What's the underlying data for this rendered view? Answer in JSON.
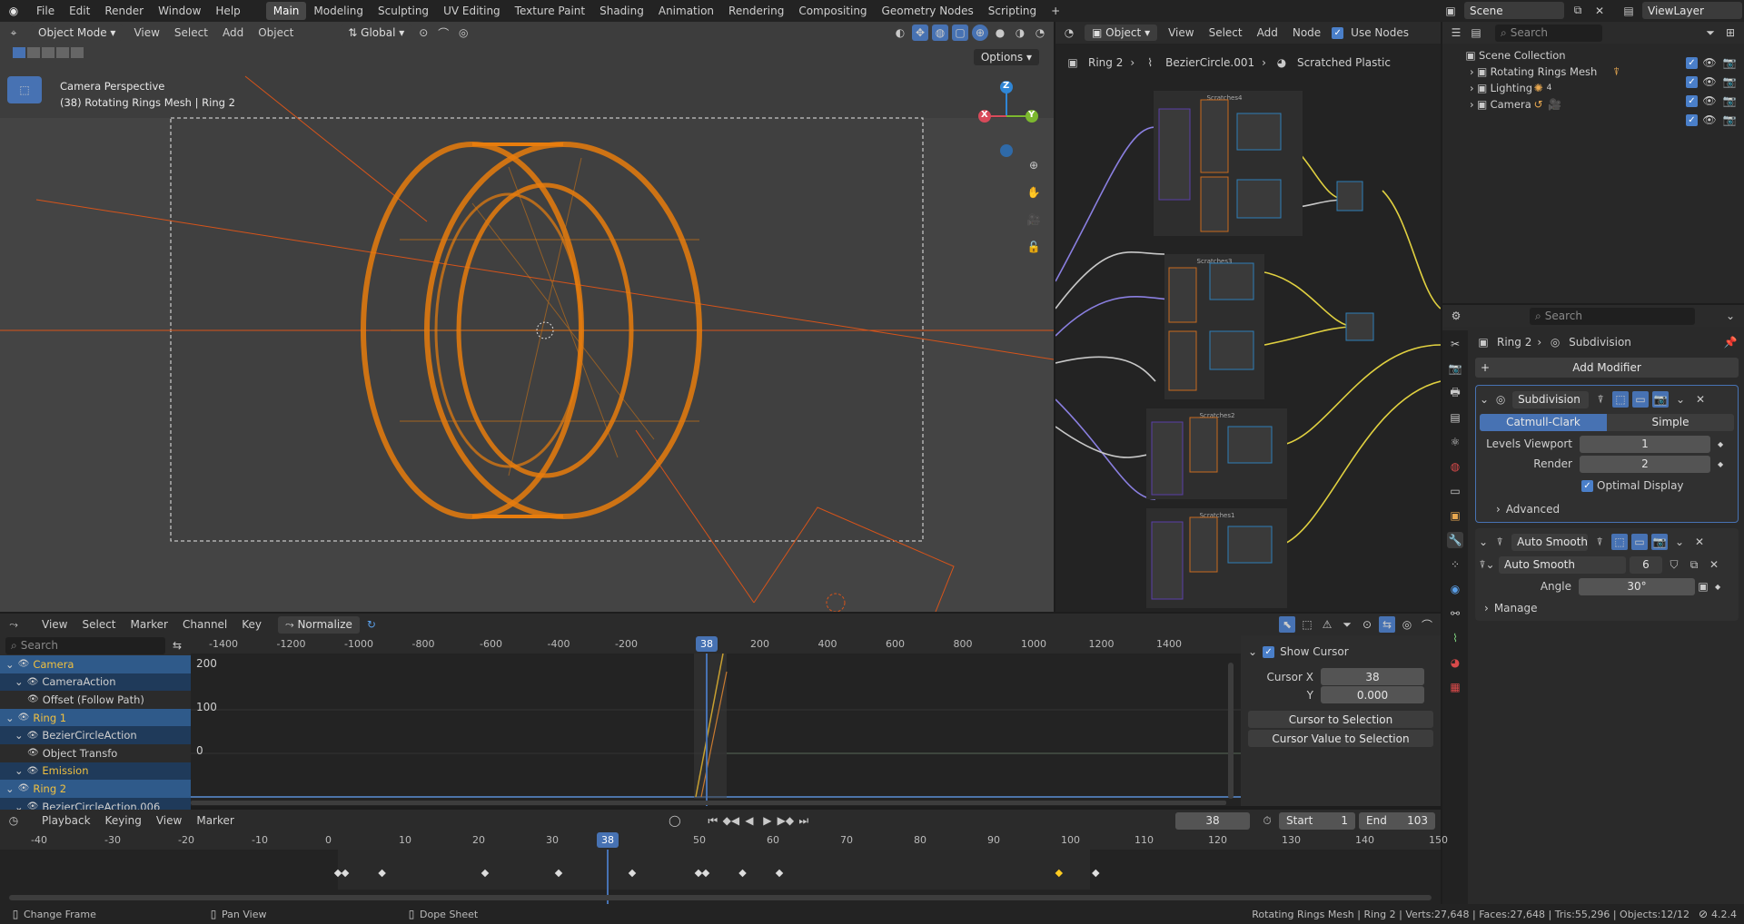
{
  "topbar": {
    "menus": [
      "File",
      "Edit",
      "Render",
      "Window",
      "Help"
    ],
    "workspaces": [
      "Main",
      "Modeling",
      "Sculpting",
      "UV Editing",
      "Texture Paint",
      "Shading",
      "Animation",
      "Rendering",
      "Compositing",
      "Geometry Nodes",
      "Scripting"
    ],
    "active_workspace": "Main",
    "add_tab": "+",
    "scene_label": "Scene",
    "viewlayer_label": "ViewLayer"
  },
  "viewport": {
    "mode": "Object Mode",
    "menus": [
      "View",
      "Select",
      "Add",
      "Object"
    ],
    "orientation": "Global",
    "options_label": "Options",
    "overlay_title": "Camera Perspective",
    "overlay_subtitle": "(38) Rotating Rings Mesh | Ring 2",
    "gizmo": {
      "x": "X",
      "y": "Y",
      "z": "Z"
    }
  },
  "node_editor": {
    "type": "Object",
    "menus": [
      "View",
      "Select",
      "Add",
      "Node"
    ],
    "use_nodes_label": "Use Nodes",
    "breadcrumb": [
      "Ring 2",
      "BezierCircle.001",
      "Scratched Plastic"
    ],
    "frame_titles": [
      "Scratches4",
      "Scratches3",
      "Scratches2",
      "Scratches1"
    ]
  },
  "outliner": {
    "search_placeholder": "Search",
    "root": "Scene Collection",
    "items": [
      {
        "label": "Rotating Rings Mesh"
      },
      {
        "label": "Lighting",
        "badge": "4"
      },
      {
        "label": "Camera"
      }
    ]
  },
  "properties": {
    "search_placeholder": "Search",
    "breadcrumb_object": "Ring 2",
    "breadcrumb_modifier": "Subdivision",
    "add_modifier": "Add Modifier",
    "subdivision": {
      "name": "Subdivision",
      "mode_a": "Catmull-Clark",
      "mode_b": "Simple",
      "levels_label": "Levels Viewport",
      "levels_value": "1",
      "render_label": "Render",
      "render_value": "2",
      "optimal_label": "Optimal Display",
      "advanced_label": "Advanced"
    },
    "autosmooth": {
      "name": "Auto Smooth",
      "node_group": "Auto Smooth",
      "users": "6",
      "angle_label": "Angle",
      "angle_value": "30°",
      "manage_label": "Manage"
    }
  },
  "graph": {
    "menus": [
      "View",
      "Select",
      "Marker",
      "Channel",
      "Key"
    ],
    "normalize_label": "Normalize",
    "search_placeholder": "Search",
    "ruler": [
      "-1400",
      "-1200",
      "-1000",
      "-800",
      "-600",
      "-400",
      "-200",
      "",
      "200",
      "400",
      "600",
      "800",
      "1000",
      "1200",
      "1400"
    ],
    "current": "38",
    "yticks": [
      "200",
      "100",
      "0"
    ],
    "channels": [
      {
        "label": "Camera",
        "type": "object",
        "indent": 0
      },
      {
        "label": "CameraAction",
        "type": "action",
        "indent": 1
      },
      {
        "label": "Offset (Follow Path)",
        "type": "fcurve",
        "indent": 2
      },
      {
        "label": "Ring 1",
        "type": "object",
        "indent": 0
      },
      {
        "label": "BezierCircleAction",
        "type": "action",
        "indent": 1
      },
      {
        "label": "Object Transfo",
        "type": "fcurve",
        "indent": 2
      },
      {
        "label": "Emission",
        "type": "material",
        "indent": 1
      },
      {
        "label": "Ring 2",
        "type": "object",
        "indent": 0
      },
      {
        "label": "BezierCircleAction.006",
        "type": "action",
        "indent": 1
      }
    ],
    "sidebar": {
      "show_cursor": "Show Cursor",
      "cursor_x_label": "Cursor X",
      "cursor_x": "38",
      "y_label": "Y",
      "y_value": "0.000",
      "to_selection": "Cursor to Selection",
      "value_to_selection": "Cursor Value to Selection"
    }
  },
  "timeline": {
    "menus": [
      "Playback",
      "Keying",
      "View",
      "Marker"
    ],
    "current_frame": "38",
    "start_label": "Start",
    "start_value": "1",
    "end_label": "End",
    "end_value": "103",
    "ruler": [
      "-40",
      "-30",
      "-20",
      "-10",
      "0",
      "10",
      "20",
      "30",
      "",
      "50",
      "60",
      "70",
      "80",
      "90",
      "100",
      "110",
      "120",
      "130",
      "140",
      "150"
    ],
    "keyframes": [
      0,
      1,
      6,
      20,
      30,
      40,
      49,
      50,
      55,
      60,
      98,
      103
    ],
    "active_keyframe": 98
  },
  "statusbar": {
    "hint1": "Change Frame",
    "hint2": "Pan View",
    "hint3": "Dope Sheet",
    "stats": "Rotating Rings Mesh | Ring 2 | Verts:27,648 | Faces:27,648 | Tris:55,296 | Objects:12/12",
    "version": "4.2.4"
  },
  "colors": {
    "accent": "#4772b3",
    "selection_orange": "#e87d0d",
    "active_key": "#ffcc22"
  }
}
